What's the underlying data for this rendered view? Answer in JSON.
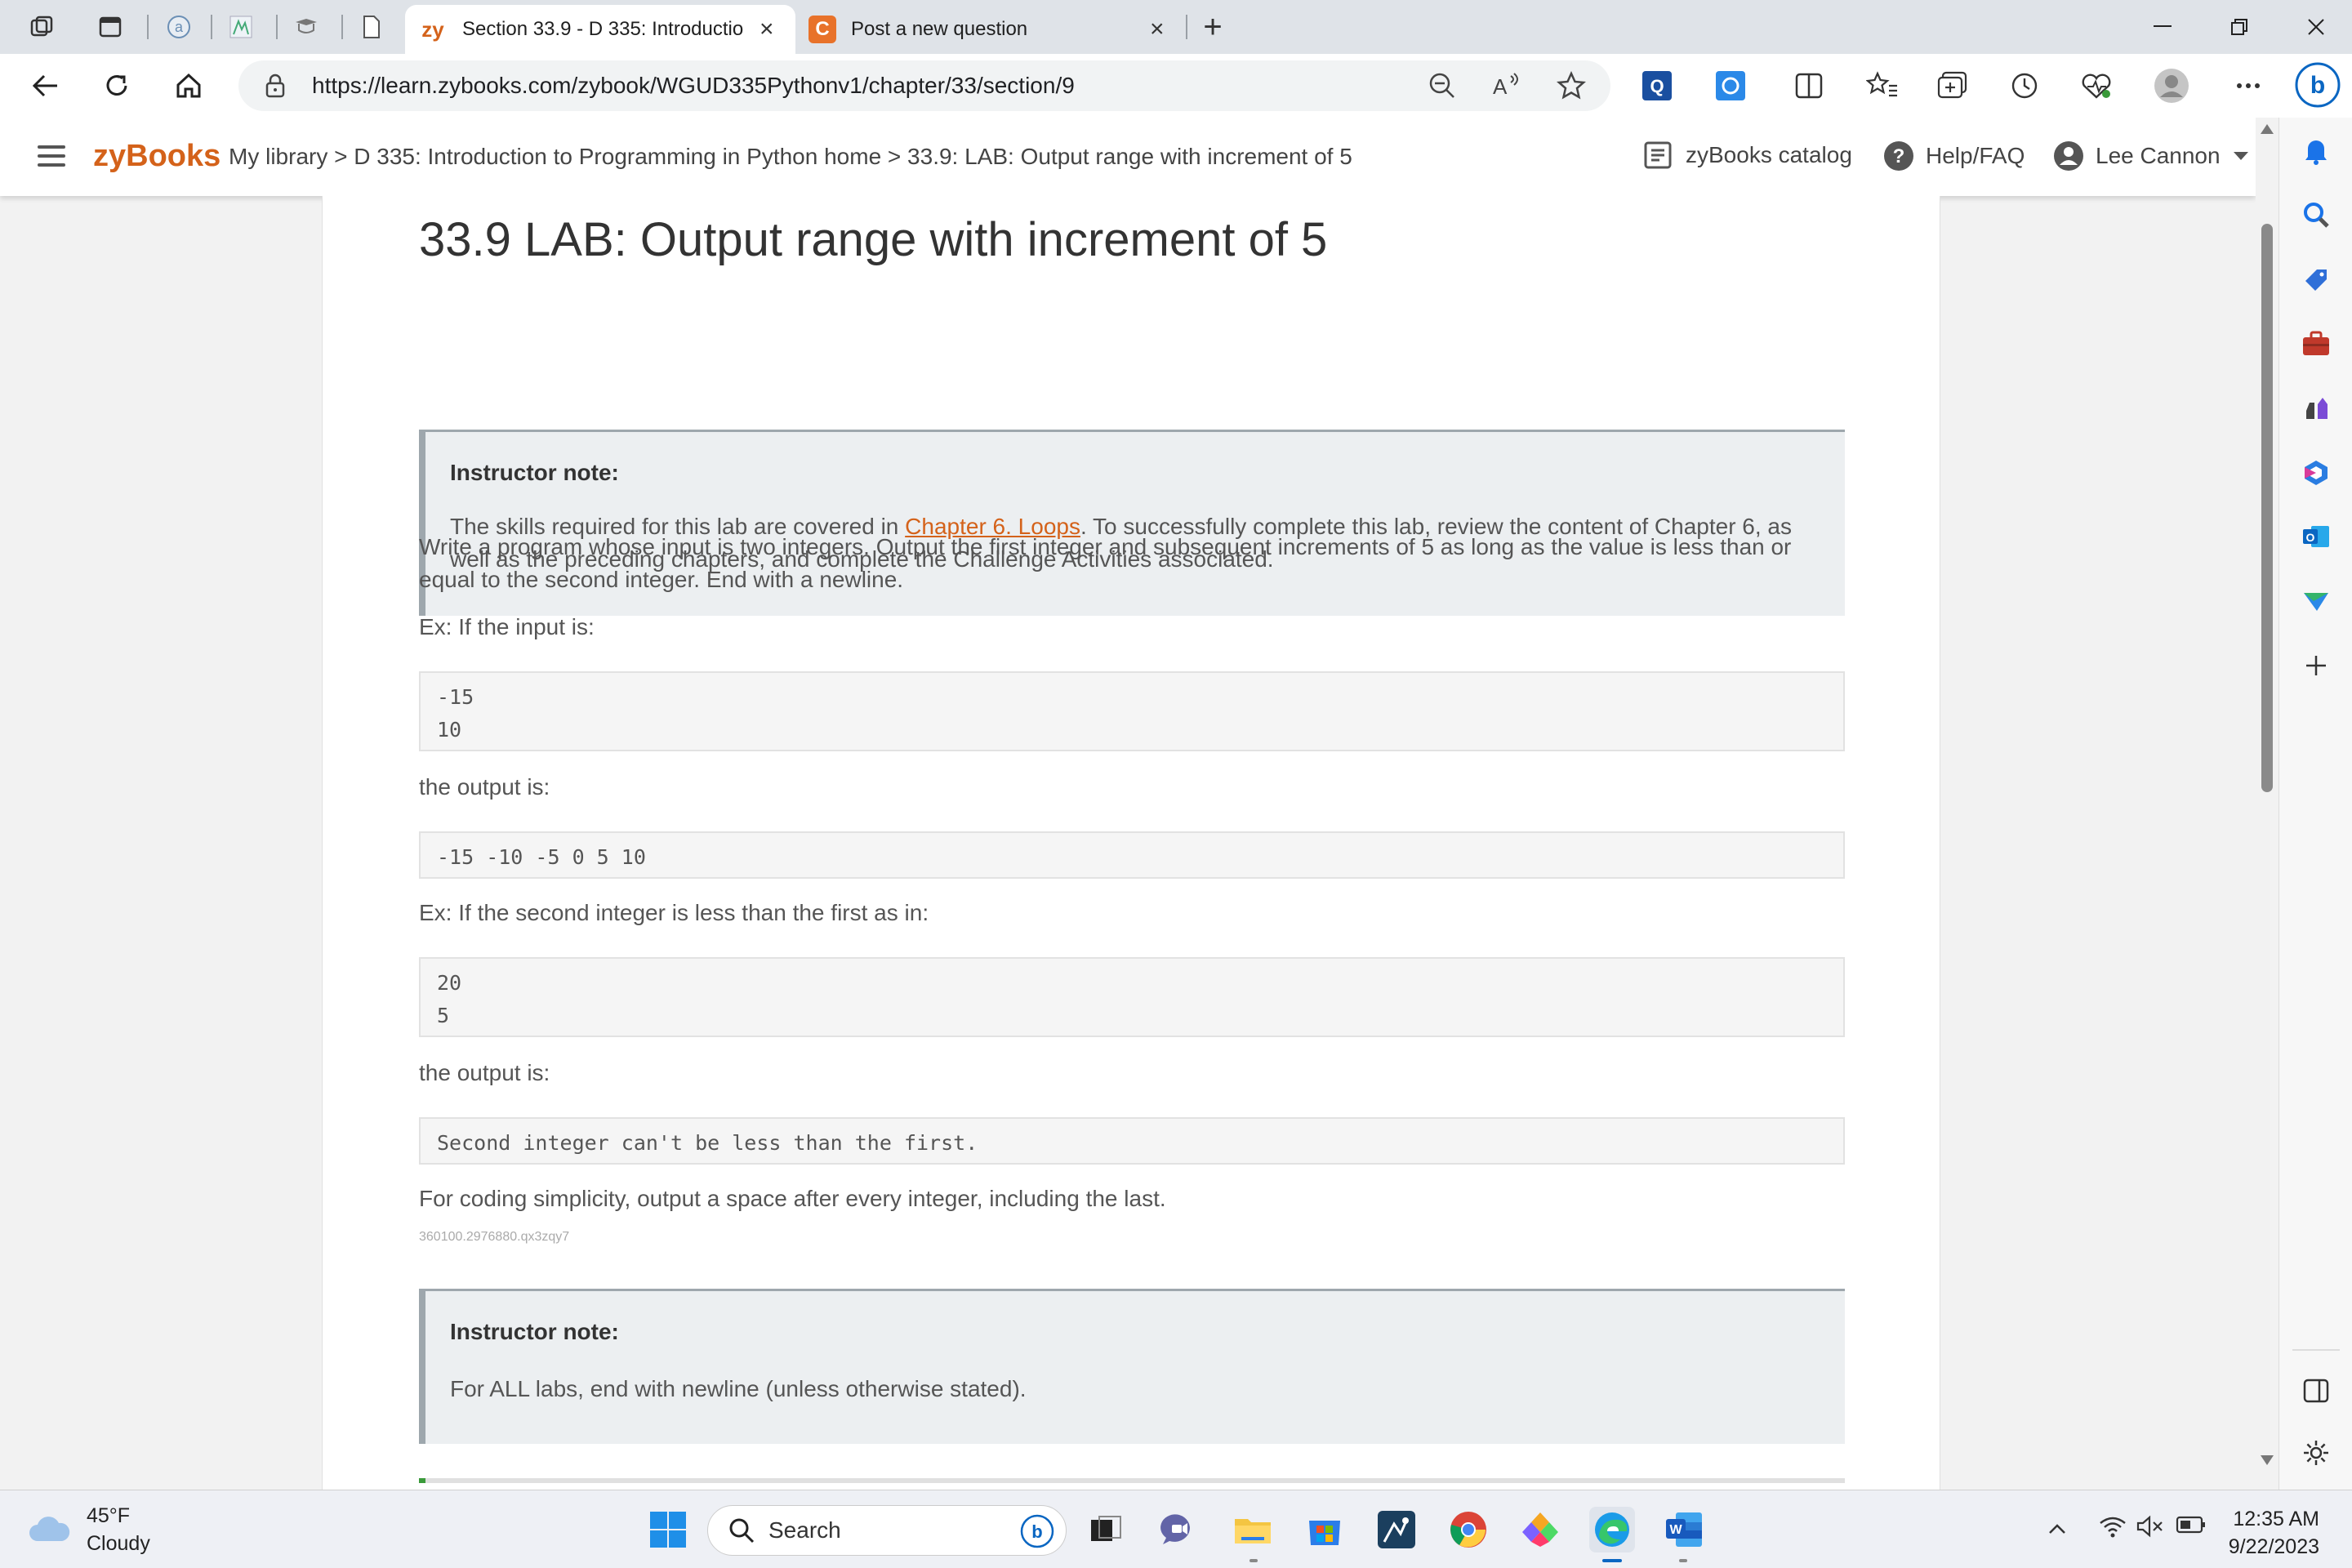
{
  "browser": {
    "tabs": [
      {
        "label": "Section 33.9 - D 335: Introductio",
        "favicon": "zy",
        "active": true
      },
      {
        "label": "Post a new question",
        "favicon": "C",
        "active": false
      }
    ],
    "new_tab_symbol": "+",
    "close_symbol": "×",
    "url": "https://learn.zybooks.com/zybook/WGUD335Pythonv1/chapter/33/section/9",
    "profile_letter": "b"
  },
  "zyheader": {
    "logo": "zyBooks",
    "breadcrumb": "My library > D 335: Introduction to Programming in Python home > 33.9: LAB: Output range with increment of 5",
    "catalog": "zyBooks catalog",
    "help": "Help/FAQ",
    "user": "Lee Cannon"
  },
  "content": {
    "title": "33.9 LAB: Output range with increment of 5",
    "note1": {
      "heading": "Instructor note:",
      "text_before": "The skills required for this lab are covered in ",
      "link": "Chapter 6. Loops",
      "text_after": ". To successfully complete this lab, review the content of Chapter 6, as well as the preceding chapters, and complete the Challenge Activities associated."
    },
    "intro": "Write a program whose input is two integers. Output the first integer and subsequent increments of 5 as long as the value is less than or equal to the second integer. End with a newline.",
    "ex1_label": "Ex: If the input is:",
    "ex1_input": [
      "-15",
      "10"
    ],
    "output_label_1": "the output is:",
    "ex1_output": "-15 -10 -5 0 5 10",
    "ex2_label": "Ex: If the second integer is less than the first as in:",
    "ex2_input": [
      "20",
      "5"
    ],
    "output_label_2": "the output is:",
    "ex2_output": "Second integer can't be less than the first.",
    "simplicity": "For coding simplicity, output a space after every integer, including the last.",
    "tiny_id": "360100.2976880.qx3zqy7",
    "note2": {
      "heading": "Instructor note:",
      "text": "For ALL labs, end with newline (unless otherwise stated)."
    }
  },
  "taskbar": {
    "weather_temp": "45°F",
    "weather_desc": "Cloudy",
    "search": "Search",
    "time": "12:35 AM",
    "date": "9/22/2023"
  },
  "colors": {
    "zy_orange": "#d4621a",
    "note_bg": "#eceff1",
    "note_border": "#9ea7ad",
    "edge_blue": "#0a66c2"
  }
}
